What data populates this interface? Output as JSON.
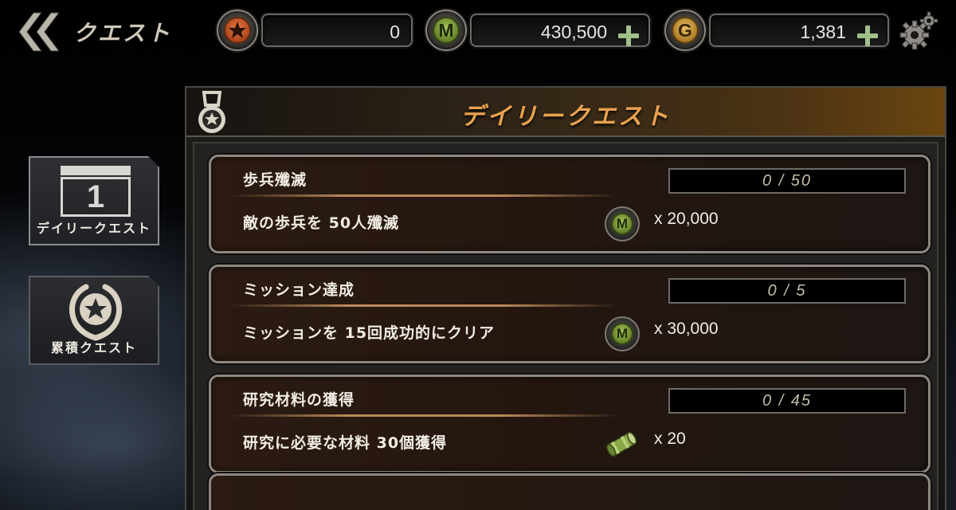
{
  "header": {
    "title": "クエスト",
    "back_icon": "double-chevron-left-icon",
    "settings_icon": "gear-icon"
  },
  "currencies": [
    {
      "id": "star",
      "icon": "star-icon",
      "symbol": "",
      "value": "0",
      "has_plus": false
    },
    {
      "id": "m",
      "icon": "m-coin-icon",
      "symbol": "M",
      "value": "430,500",
      "has_plus": true
    },
    {
      "id": "g",
      "icon": "g-coin-icon",
      "symbol": "G",
      "value": "1,381",
      "has_plus": true
    }
  ],
  "sidebar": {
    "tabs": [
      {
        "label": "デイリークエスト",
        "icon": "calendar-icon",
        "icon_text": "1",
        "active": true
      },
      {
        "label": "累積クエスト",
        "icon": "laurel-star-icon",
        "active": false
      }
    ]
  },
  "panel": {
    "title": "デイリークエスト",
    "icon": "medal-icon"
  },
  "quests": [
    {
      "name": "歩兵殲滅",
      "description": "敵の歩兵を 50人殲滅",
      "progress_text": "0 / 50",
      "progress": 0,
      "reward_icon": "m-coin-icon",
      "reward_symbol": "M",
      "reward_amount": "x 20,000"
    },
    {
      "name": "ミッション達成",
      "description": "ミッションを 15回成功的にクリア",
      "progress_text": "0 / 5",
      "progress": 0,
      "reward_icon": "m-coin-icon",
      "reward_symbol": "M",
      "reward_amount": "x 30,000"
    },
    {
      "name": "研究材料の獲得",
      "description": "研究に必要な材料 30個獲得",
      "progress_text": "0 / 45",
      "progress": 0,
      "reward_icon": "material-cylinder-icon",
      "reward_symbol": "",
      "reward_amount": "x 20"
    }
  ],
  "colors": {
    "panel_title": "#e9a24f",
    "m_coin": "#7f9d3c",
    "g_coin": "#c8973f",
    "star_coin": "#d8612b",
    "plus": "#9fc08a"
  }
}
